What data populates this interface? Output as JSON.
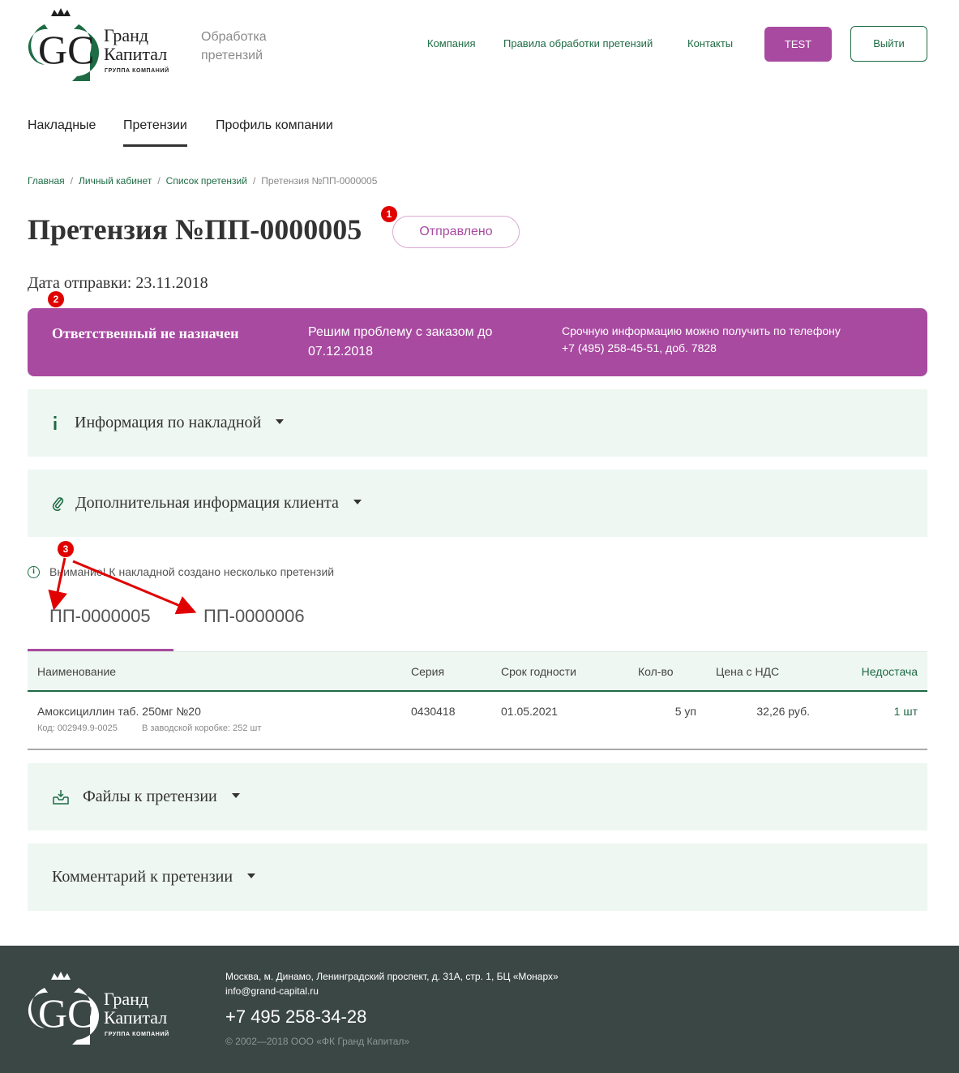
{
  "brand": {
    "name_line1": "Гранд",
    "name_line2": "Капитал",
    "group_label": "ГРУППА КОМПАНИЙ",
    "monogram": "GC",
    "subtitle_line1": "Обработка",
    "subtitle_line2": "претензий"
  },
  "topnav": {
    "items": [
      "Компания",
      "Правила обработки претензий",
      "Контакты"
    ],
    "test_label": "TEST",
    "logout_label": "Выйти"
  },
  "maintabs": {
    "items": [
      "Накладные",
      "Претензии",
      "Профиль компании"
    ],
    "active": "Претензии"
  },
  "breadcrumb": {
    "items": [
      "Главная",
      "Личный кабинет",
      "Список претензий",
      "Претензия №ПП-0000005"
    ],
    "separator": "/"
  },
  "claim": {
    "title": "Претензия №ПП-0000005",
    "status": "Отправлено",
    "send_date": "Дата отправки: 23.11.2018"
  },
  "annotations": [
    "1",
    "2",
    "3"
  ],
  "banner": {
    "responsible": "Ответственный не назначен",
    "resolve_line1": "Решим проблему с заказом до",
    "resolve_line2": "07.12.2018",
    "phone_line1": "Срочную информацию можно получить по телефону",
    "phone_line2": "+7 (495) 258-45-51, доб. 7828"
  },
  "sections": {
    "invoice_info": "Информация по накладной",
    "client_info": "Дополнительная информация клиента",
    "files": "Файлы к претензии",
    "comment": "Комментарий к претензии"
  },
  "notice": {
    "text": "Внимание! К накладной создано несколько претензий"
  },
  "claim_tabs": {
    "items": [
      "ПП-0000005",
      "ПП-0000006"
    ],
    "active": "ПП-0000005"
  },
  "table": {
    "columns": [
      "Наименование",
      "Серия",
      "Срок годности",
      "Кол-во",
      "Цена с НДС",
      "Недостача"
    ],
    "rows": [
      {
        "name": "Амоксициллин таб. 250мг №20",
        "code": "Код: 002949.9-0025",
        "box": "В заводской коробке: 252 шт",
        "series": "0430418",
        "expiry": "01.05.2021",
        "qty": "5 уп",
        "price": "32,26 руб.",
        "shortage": "1 шт"
      }
    ]
  },
  "footer": {
    "address": "Москва, м. Динамо, Ленинградский проспект, д. 31А, стр. 1, БЦ «Монарх»",
    "email": "info@grand-capital.ru",
    "phone": "+7 495 258-34-28",
    "copyright": "© 2002—2018 ООО «ФК Гранд Капитал»"
  },
  "colors": {
    "brand_green": "#1e6b44",
    "accent_purple": "#a84aa0",
    "section_bg": "#eff7f3",
    "footer_bg": "#3b4745",
    "marker_red": "#e00000"
  }
}
